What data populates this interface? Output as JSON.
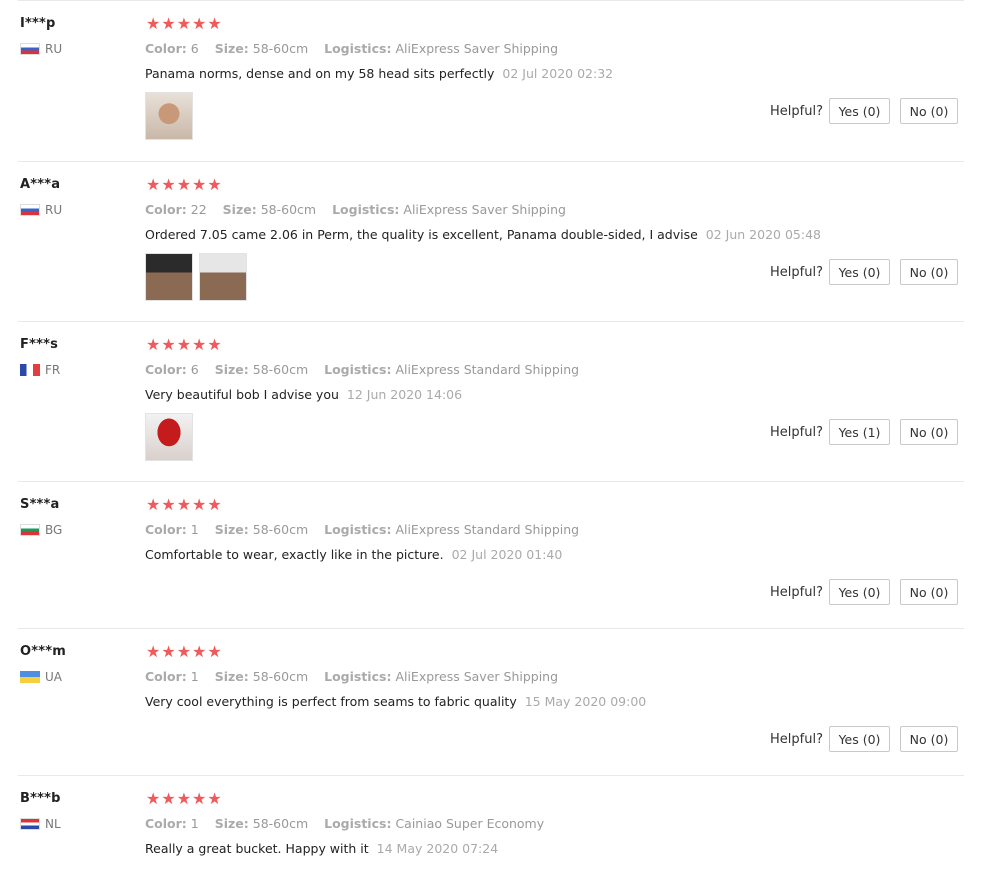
{
  "reviews": [
    {
      "user": "I***p",
      "country": "RU",
      "flag": "ru",
      "stars": "★★★★★",
      "color_label": "Color:",
      "color": "6",
      "size_label": "Size:",
      "size": "58-60cm",
      "logistics_label": "Logistics:",
      "logistics": "AliExpress Saver Shipping",
      "text": "Panama norms, dense and on my 58 head sits perfectly",
      "date": "02 Jul 2020 02:32",
      "photos": 1,
      "helpful_label": "Helpful?",
      "yes": "Yes (0)",
      "no": "No (0)"
    },
    {
      "user": "A***a",
      "country": "RU",
      "flag": "ru",
      "stars": "★★★★★",
      "color_label": "Color:",
      "color": "22",
      "size_label": "Size:",
      "size": "58-60cm",
      "logistics_label": "Logistics:",
      "logistics": "AliExpress Saver Shipping",
      "text": "Ordered 7.05 came 2.06 in Perm, the quality is excellent, Panama double-sided, I advise",
      "date": "02 Jun 2020 05:48",
      "photos": 2,
      "helpful_label": "Helpful?",
      "yes": "Yes (0)",
      "no": "No (0)"
    },
    {
      "user": "F***s",
      "country": "FR",
      "flag": "fr",
      "stars": "★★★★★",
      "color_label": "Color:",
      "color": "6",
      "size_label": "Size:",
      "size": "58-60cm",
      "logistics_label": "Logistics:",
      "logistics": "AliExpress Standard Shipping",
      "text": "Very beautiful bob I advise you",
      "date": "12 Jun 2020 14:06",
      "photos": 1,
      "helpful_label": "Helpful?",
      "yes": "Yes (1)",
      "no": "No (0)"
    },
    {
      "user": "S***a",
      "country": "BG",
      "flag": "bg",
      "stars": "★★★★★",
      "color_label": "Color:",
      "color": "1",
      "size_label": "Size:",
      "size": "58-60cm",
      "logistics_label": "Logistics:",
      "logistics": "AliExpress Standard Shipping",
      "text": "Comfortable to wear, exactly like in the picture.",
      "date": "02 Jul 2020 01:40",
      "photos": 0,
      "helpful_label": "Helpful?",
      "yes": "Yes (0)",
      "no": "No (0)"
    },
    {
      "user": "O***m",
      "country": "UA",
      "flag": "ua",
      "stars": "★★★★★",
      "color_label": "Color:",
      "color": "1",
      "size_label": "Size:",
      "size": "58-60cm",
      "logistics_label": "Logistics:",
      "logistics": "AliExpress Saver Shipping",
      "text": "Very cool everything is perfect from seams to fabric quality",
      "date": "15 May 2020 09:00",
      "photos": 0,
      "helpful_label": "Helpful?",
      "yes": "Yes (0)",
      "no": "No (0)"
    },
    {
      "user": "B***b",
      "country": "NL",
      "flag": "nl",
      "stars": "★★★★★",
      "color_label": "Color:",
      "color": "1",
      "size_label": "Size:",
      "size": "58-60cm",
      "logistics_label": "Logistics:",
      "logistics": "Cainiao Super Economy",
      "text": "Really a great bucket. Happy with it",
      "date": "14 May 2020 07:24",
      "photos": 0,
      "helpful_label": "",
      "yes": "",
      "no": ""
    }
  ],
  "colors": {
    "stars": "#f05a5a",
    "separator": "#e8e8e8",
    "muted": "#999999"
  }
}
